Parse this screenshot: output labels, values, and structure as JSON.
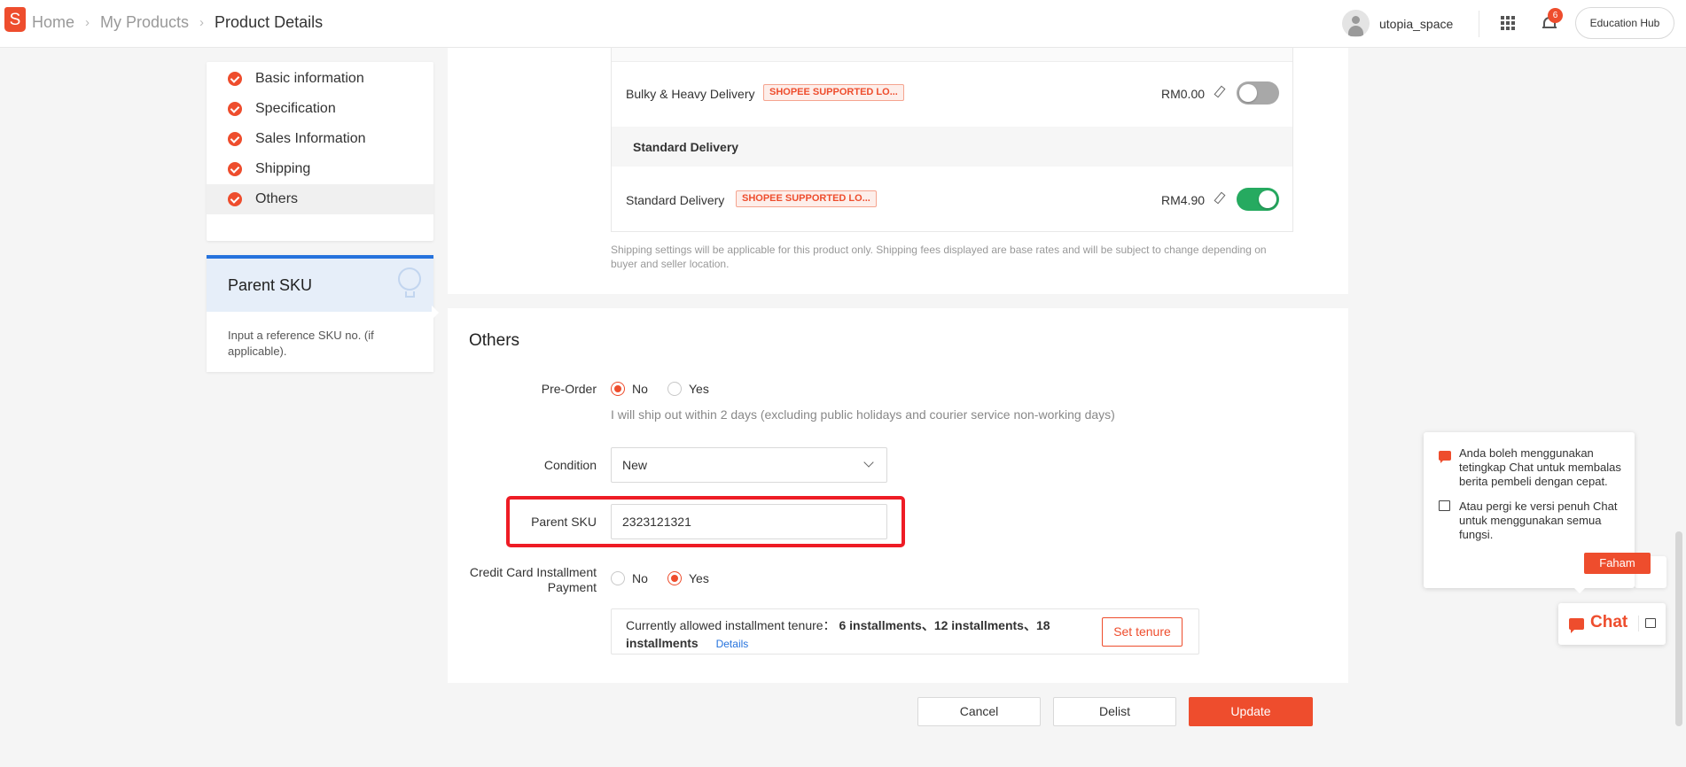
{
  "header": {
    "breadcrumbs": [
      "Home",
      "My Products",
      "Product Details"
    ],
    "username": "utopia_space",
    "notification_count": "6",
    "education_hub": "Education Hub",
    "logo_letter": "S"
  },
  "sidebar": {
    "items": [
      {
        "label": "Basic information"
      },
      {
        "label": "Specification"
      },
      {
        "label": "Sales Information"
      },
      {
        "label": "Shipping"
      },
      {
        "label": "Others"
      }
    ],
    "active_item": "Others"
  },
  "tip": {
    "title": "Parent SKU",
    "text": "Input a reference SKU no. (if applicable)."
  },
  "shipping": {
    "rows": [
      {
        "name": "Bulky & Heavy Delivery",
        "tag": "SHOPEE SUPPORTED LO...",
        "price": "RM0.00",
        "enabled": false
      },
      {
        "name": "Standard Delivery",
        "tag": "SHOPEE SUPPORTED LO...",
        "price": "RM4.90",
        "enabled": true
      }
    ],
    "group_label": "Standard Delivery",
    "note": "Shipping settings will be applicable for this product only. Shipping fees displayed are base rates and will be subject to change depending on buyer and seller location."
  },
  "others": {
    "title": "Others",
    "preorder": {
      "label": "Pre-Order",
      "options": [
        "No",
        "Yes"
      ],
      "selected": "No",
      "hint": "I will ship out within 2 days (excluding public holidays and courier service non-working days)"
    },
    "condition": {
      "label": "Condition",
      "value": "New"
    },
    "parent_sku": {
      "label": "Parent SKU",
      "value": "2323121321"
    },
    "installment": {
      "label_line1": "Credit Card Installment",
      "label_line2": "Payment",
      "options": [
        "No",
        "Yes"
      ],
      "selected": "Yes",
      "tenure_prefix": "Currently allowed installment tenure：",
      "tenure_value_line1": "6 installments、12 installments、18",
      "tenure_value_line2": "installments",
      "details_link": "Details",
      "set_tenure": "Set tenure"
    }
  },
  "footer": {
    "cancel": "Cancel",
    "delist": "Delist",
    "update": "Update"
  },
  "chat": {
    "tip_line1": "Anda boleh menggunakan tetingkap Chat untuk membalas berita pembeli dengan cepat.",
    "tip_line2": "Atau pergi ke versi penuh Chat untuk menggunakan semua fungsi.",
    "faham": "Faham",
    "chat_label": "Chat"
  },
  "colors": {
    "brand": "#ee4d2d",
    "toggle_on": "#26aa60",
    "link": "#2673dd"
  }
}
